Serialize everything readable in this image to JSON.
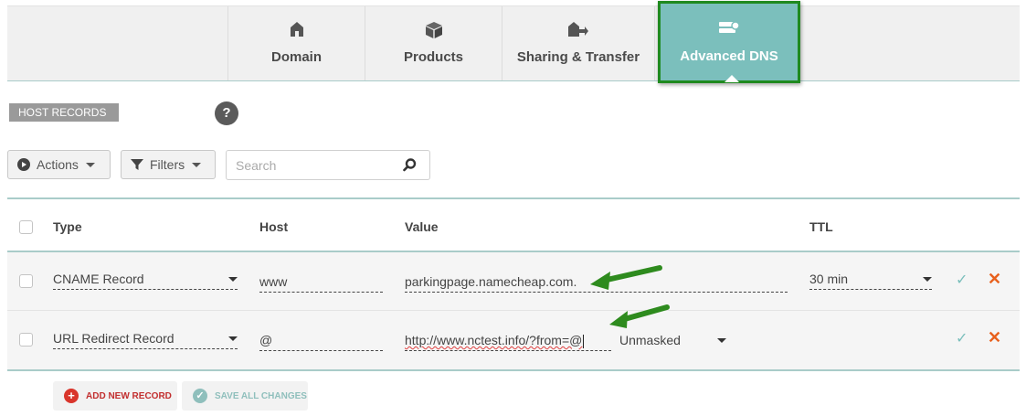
{
  "nav": {
    "tabs": [
      {
        "label": "Domain",
        "icon": "home-icon"
      },
      {
        "label": "Products",
        "icon": "box-icon"
      },
      {
        "label": "Sharing & Transfer",
        "icon": "home-transfer-icon"
      },
      {
        "label": "Advanced DNS",
        "icon": "server-icon",
        "active": true
      }
    ]
  },
  "section": {
    "host_records_label": "HOST RECORDS",
    "help": "?"
  },
  "toolbar": {
    "actions_label": "Actions",
    "filters_label": "Filters",
    "search_placeholder": "Search"
  },
  "table": {
    "headers": {
      "type": "Type",
      "host": "Host",
      "value": "Value",
      "ttl": "TTL"
    },
    "rows": [
      {
        "type": "CNAME Record",
        "host": "www",
        "value": "parkingpage.namecheap.com.",
        "ttl": "30 min"
      },
      {
        "type": "URL Redirect Record",
        "host": "@",
        "value": "http://www.nctest.info/?from=@",
        "mask": "Unmasked"
      }
    ]
  },
  "footer": {
    "add_label": "ADD NEW RECORD",
    "save_label": "SAVE ALL CHANGES"
  },
  "colors": {
    "accent": "#7bbfbc",
    "highlight_border": "#1f8a1f",
    "delete": "#e8601c",
    "annotation_arrow": "#2e8b1e"
  }
}
